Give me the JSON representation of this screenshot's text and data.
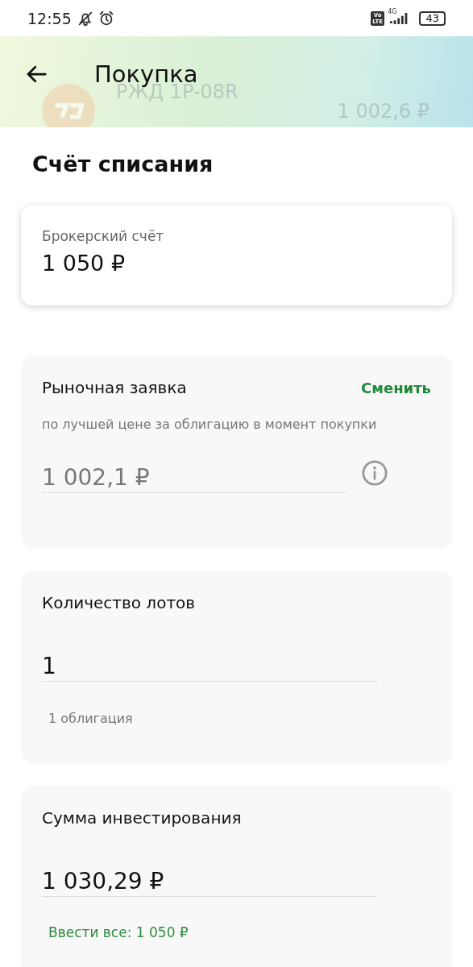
{
  "status_bar": {
    "time": "12:55",
    "volte_badge": [
      "Vo",
      "LTE"
    ],
    "network": "4G",
    "battery": "43"
  },
  "header": {
    "title": "Покупка",
    "bond": {
      "name": "РЖД 1P-08R",
      "price": "1 002,6 ₽"
    }
  },
  "debit": {
    "heading": "Счёт списания",
    "account": {
      "label": "Брокерский счёт",
      "amount": "1 050 ₽"
    }
  },
  "order": {
    "title": "Рыночная заявка",
    "action": "Сменить",
    "note": "по лучшей цене за облигацию в момент покупки",
    "price": {
      "value": "1 002,1 ₽",
      "disabled": true
    }
  },
  "lots": {
    "title": "Количество лотов",
    "value": "1",
    "disabled": false,
    "hint": "1 облигация"
  },
  "sum": {
    "title": "Сумма инвестирования",
    "value": "1 030,29 ₽",
    "disabled": false,
    "action": "Ввести все: 1 050 ₽"
  }
}
